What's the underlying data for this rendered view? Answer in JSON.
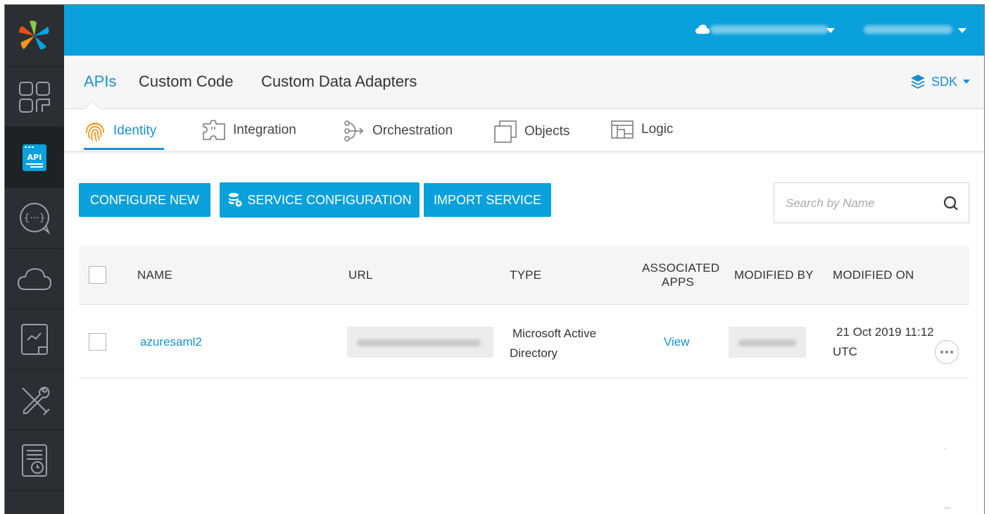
{
  "header": {
    "account_name": "••••••••••••",
    "user_name": "•••••••••"
  },
  "primary_tabs": [
    {
      "label": "APIs"
    },
    {
      "label": "Custom Code"
    },
    {
      "label": "Custom Data Adapters"
    }
  ],
  "sdk_label": "SDK",
  "secondary_tabs": [
    {
      "label": "Identity"
    },
    {
      "label": "Integration"
    },
    {
      "label": "Orchestration"
    },
    {
      "label": "Objects"
    },
    {
      "label": "Logic"
    }
  ],
  "actions": {
    "configure_new": "CONFIGURE NEW",
    "service_configuration": "SERVICE CONFIGURATION",
    "import_service": "IMPORT SERVICE"
  },
  "search": {
    "placeholder": "Search by Name",
    "value": ""
  },
  "table": {
    "columns": {
      "name": "NAME",
      "url": "URL",
      "type": "TYPE",
      "associated_apps_line1": "ASSOCIATED",
      "associated_apps_line2": "APPS",
      "modified_by": "MODIFIED BY",
      "modified_on": "MODIFIED ON"
    },
    "rows": [
      {
        "name": "azuresaml2",
        "type_line1": "Microsoft Active",
        "type_line2": "Directory",
        "associated_apps": "View",
        "modified_on_line1": "21 Oct 2019 11:12",
        "modified_on_line2": "UTC"
      }
    ]
  },
  "colors": {
    "brand_blue": "#0aa0db",
    "link_blue": "#1a8fd0",
    "nav_dark": "#2b2f33",
    "identity_orange": "#f7941d"
  }
}
